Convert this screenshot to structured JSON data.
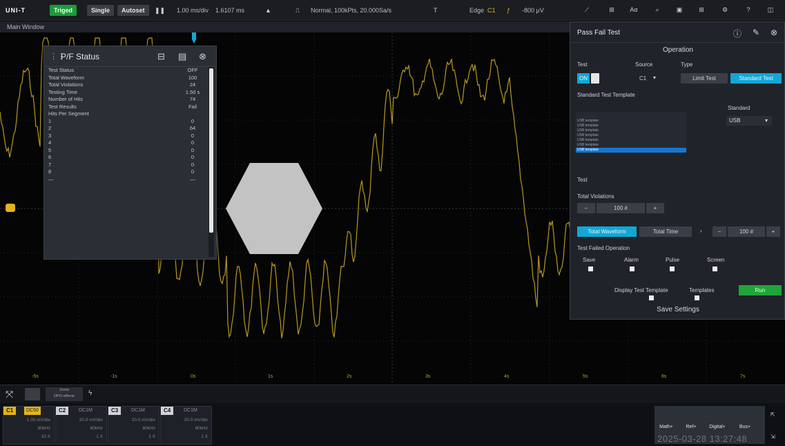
{
  "topbar": {
    "logo": "UNI-T",
    "trigger_state": "Triged",
    "single_label": "Single",
    "autoset_label": "Autoset",
    "run_icon": "run-stop-icon",
    "timebase": "1.00 ms/div",
    "delay": "1.6107 ms",
    "acq_mode": "Normal, 100kPts, 20.000Sa/s",
    "trigger_type": "Edge",
    "trigger_channel": "C1",
    "trigger_level": "-800 μV",
    "right_icons": [
      "waveform-measure-icon",
      "cursor-icon",
      "auto-measure-icon",
      "search-icon",
      "save-icon",
      "app-grid-icon",
      "utility-icon",
      "help-icon",
      "window-icon"
    ]
  },
  "main_window_label": "Main Window",
  "pf_status": {
    "title": "P/F Status",
    "rows": [
      {
        "label": "Test Status",
        "value": "OFF"
      },
      {
        "label": "Total Waveform",
        "value": "100"
      },
      {
        "label": "Total Violations",
        "value": "24"
      },
      {
        "label": "Testing Time",
        "value": "1.50 s"
      },
      {
        "label": "Number of Hits",
        "value": "74"
      },
      {
        "label": "Test Results",
        "value": "Fail"
      },
      {
        "label": "Hits Per Segment",
        "value": ""
      },
      {
        "label": "1",
        "value": "0"
      },
      {
        "label": "2",
        "value": "64"
      },
      {
        "label": "3",
        "value": "0"
      },
      {
        "label": "4",
        "value": "0"
      },
      {
        "label": "5",
        "value": "0"
      },
      {
        "label": "6",
        "value": "0"
      },
      {
        "label": "7",
        "value": "0"
      },
      {
        "label": "8",
        "value": "0"
      },
      {
        "label": "—",
        "value": "—"
      }
    ]
  },
  "pass_fail_test": {
    "title": "Pass Fail Test",
    "operation_header": "Operation",
    "test_label": "Test",
    "test_on": "ON",
    "source_label": "Source",
    "source_value": "C1",
    "type_label": "Type",
    "type_options": [
      "Limit Test",
      "Standard Test"
    ],
    "template_label": "Standard Test Template",
    "template_items": [
      "USB template",
      "USB template",
      "USB template",
      "USB template",
      "USB template",
      "USB template",
      "USB template"
    ],
    "standard_label": "Standard",
    "standard_value": "USB",
    "test_label2": "Test",
    "total_violations_label": "Total Violations",
    "total_violations_value": "100 #",
    "stop_options": [
      "Total Waveform",
      "Total Time"
    ],
    "stop_value": "100 #",
    "failed_op_label": "Test Failed Operation",
    "failed_ops": [
      "Save",
      "Alarm",
      "Pulse",
      "Screen"
    ],
    "display_template_label": "Display Test Template",
    "templates_label": "Templates",
    "run_label": "Run",
    "save_settings_label": "Save Settings"
  },
  "time_ticks": [
    "-5s",
    "-1s",
    "0s",
    "1s",
    "2s",
    "3s",
    "4s",
    "5s",
    "6s",
    "7s"
  ],
  "bottom": {
    "cursor_label": "Zoom",
    "timestamp_small": "DPO-effects",
    "channels": [
      {
        "name": "C1",
        "coupling": "DC50",
        "line1": "1.00 mV/div",
        "line2": "80kHz",
        "line3": "10 X",
        "color": "#e3b21c"
      },
      {
        "name": "C2",
        "coupling": "DC1M",
        "line1": "20.0 mV/div",
        "line2": "80kHz",
        "line3": "1 X",
        "color": "#cfd3d9"
      },
      {
        "name": "C3",
        "coupling": "DC1M",
        "line1": "20.0 mV/div",
        "line2": "80kHz",
        "line3": "1 X",
        "color": "#cfd3d9"
      },
      {
        "name": "C4",
        "coupling": "DC1M",
        "line1": "20.0 mV/div",
        "line2": "80kHz",
        "line3": "1 X",
        "color": "#cfd3d9"
      }
    ],
    "math_buttons": [
      "Math+",
      "Ref+",
      "Digital+",
      "Bus+"
    ],
    "datetime": "2025-03-28 13:27:48"
  },
  "colors": {
    "waveform": "#b89a22",
    "accent_cyan": "#12a7d6",
    "accent_green": "#21a43b",
    "panel_bg": "#2a2e35"
  }
}
